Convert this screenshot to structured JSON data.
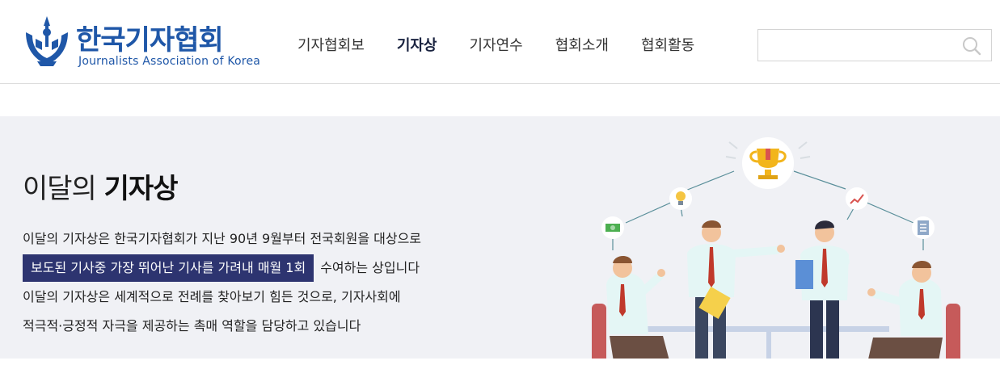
{
  "logo": {
    "title_ko": "한국기자협회",
    "title_en": "Journalists Association of Korea"
  },
  "nav": {
    "items": [
      "기자협회보",
      "기자상",
      "기자연수",
      "협회소개",
      "협회활동"
    ],
    "active_index": 1
  },
  "search": {
    "placeholder": "",
    "value": ""
  },
  "hero": {
    "title_prefix": "이달의",
    "title_bold": "기자상",
    "line1": "이달의 기자상은 한국기자협회가 지난 90년 9월부터 전국회원을 대상으로",
    "line2_highlight": "보도된 기사중 가장 뛰어난 기사를 가려내 매월 1회",
    "line2_rest": "수여하는 상입니다",
    "line3": "이달의 기자상은 세계적으로 전례를 찾아보기 힘든 것으로, 기자사회에",
    "line4": "적극적·긍정적 자극을 제공하는 촉매 역할을 담당하고 있습니다"
  },
  "colors": {
    "brand_blue": "#1f57a8",
    "highlight_bg": "#2d3470",
    "hero_bg": "#f0f1f5"
  }
}
